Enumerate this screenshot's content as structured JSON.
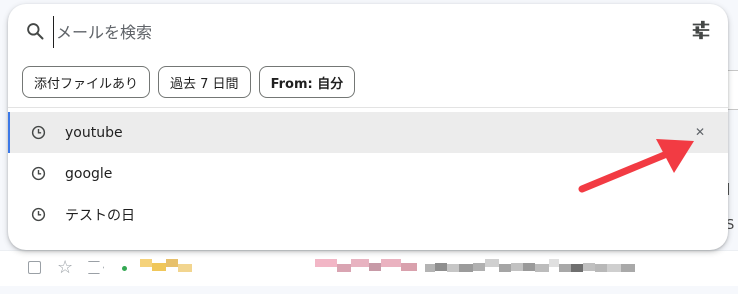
{
  "search": {
    "placeholder": "メールを検索"
  },
  "filter_chips": [
    {
      "label": "添付ファイルあり"
    },
    {
      "label": "過去 7 日間"
    },
    {
      "label": "From: 自分"
    }
  ],
  "suggestions": [
    {
      "label": "youtube",
      "icon": "history-clock-icon",
      "active": true,
      "remove_icon": "close-icon"
    },
    {
      "label": "google",
      "icon": "history-clock-icon"
    },
    {
      "label": "テストの日",
      "icon": "history-clock-icon"
    }
  ],
  "background": {
    "right_peek_1": "l",
    "right_peek_2": "S"
  },
  "colors": {
    "annotation_arrow": "#f23b43",
    "active_highlight": "#ececec",
    "active_indicator": "#3b78e7"
  }
}
